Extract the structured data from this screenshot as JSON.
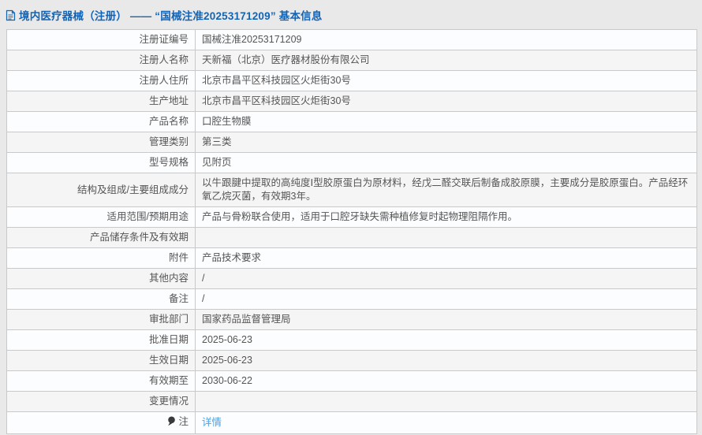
{
  "header": {
    "title": "境内医疗器械（注册） —— “国械注准20253171209” 基本信息",
    "icon": "document-icon"
  },
  "colors": {
    "accent_blue": "#1464b3",
    "link_blue": "#4aa0e0",
    "border_gray": "#c9c9c9",
    "row_alt_gray": "#f5f5f5",
    "page_bg": "#e9e9e9"
  },
  "table": {
    "rows": [
      {
        "label": "注册证编号",
        "value": "国械注准20253171209"
      },
      {
        "label": "注册人名称",
        "value": "天新福（北京）医疗器材股份有限公司"
      },
      {
        "label": "注册人住所",
        "value": "北京市昌平区科技园区火炬街30号"
      },
      {
        "label": "生产地址",
        "value": "北京市昌平区科技园区火炬街30号"
      },
      {
        "label": "产品名称",
        "value": "口腔生物膜"
      },
      {
        "label": "管理类别",
        "value": "第三类"
      },
      {
        "label": "型号规格",
        "value": "见附页"
      },
      {
        "label": "结构及组成/主要组成成分",
        "value": "以牛跟腱中提取的高纯度Ⅰ型胶原蛋白为原材料，经戊二醛交联后制备成胶原膜，主要成分是胶原蛋白。产品经环氧乙烷灭菌，有效期3年。"
      },
      {
        "label": "适用范围/预期用途",
        "value": "产品与骨粉联合使用，适用于口腔牙缺失需种植修复时起物理阻隔作用。"
      },
      {
        "label": "产品储存条件及有效期",
        "value": ""
      },
      {
        "label": "附件",
        "value": "产品技术要求"
      },
      {
        "label": "其他内容",
        "value": "/"
      },
      {
        "label": "备注",
        "value": "/"
      },
      {
        "label": "审批部门",
        "value": "国家药品监督管理局"
      },
      {
        "label": "批准日期",
        "value": "2025-06-23"
      },
      {
        "label": "生效日期",
        "value": "2025-06-23"
      },
      {
        "label": "有效期至",
        "value": "2030-06-22"
      },
      {
        "label": "变更情况",
        "value": ""
      },
      {
        "label": "注",
        "icon": "balloon-icon",
        "value": "详情",
        "value_type": "link"
      }
    ]
  }
}
